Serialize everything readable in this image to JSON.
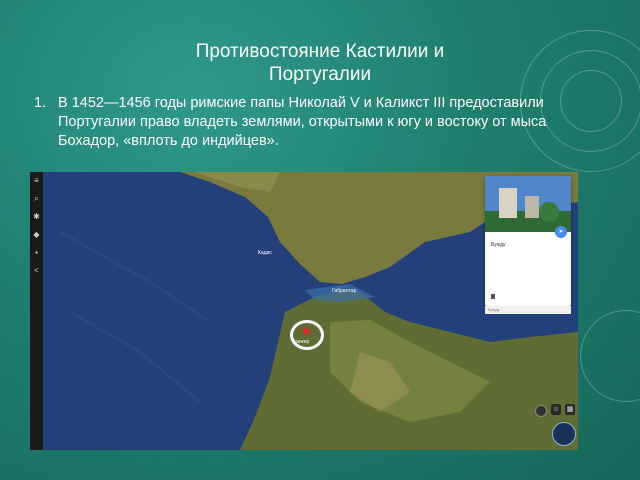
{
  "slide": {
    "title": "Противостояние Кастилии и\nПортугалии",
    "item_number": "1.",
    "item_text": "В 1452—1456 годы римские папы Николай V и Каликст III предоставили Португалии право владеть землями, открытыми к югу и востоку от мыса Бохадор, «вплоть до индийцев»."
  },
  "map": {
    "labels": {
      "gibraltar": "Гибралтар",
      "tangier": "Танжер",
      "cadiz": "Кадис"
    },
    "info_card": {
      "title": "Бужду",
      "subtitle": "Бужду"
    },
    "colors": {
      "sea": "#24407a",
      "land": "#6f7a3c",
      "toolbar": "#1a1a1a",
      "marker": "#d63131"
    },
    "icons": [
      "menu-icon",
      "search-icon",
      "voyager-icon",
      "feeling-lucky-icon",
      "projects-icon",
      "share-icon",
      "compass-icon",
      "globe-icon",
      "street-view-icon"
    ]
  }
}
